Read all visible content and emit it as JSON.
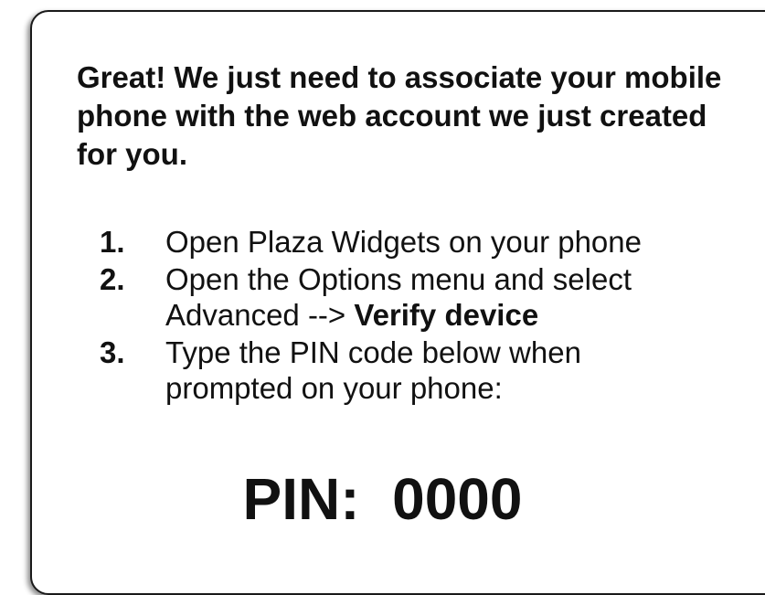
{
  "intro": "Great!  We just need to associate your mobile phone with the web account we just created for you.",
  "steps": [
    {
      "num": "1.",
      "line1": "Open Plaza Widgets on your phone"
    },
    {
      "num": "2.",
      "line1": "Open the Options menu and select",
      "line2_prefix": "Advanced --> ",
      "line2_bold": "Verify device"
    },
    {
      "num": "3.",
      "line1": "Type the PIN code below when",
      "line2": "prompted on your phone:"
    }
  ],
  "pin": {
    "label": "PIN:",
    "separator": "  ",
    "value": "0000"
  }
}
